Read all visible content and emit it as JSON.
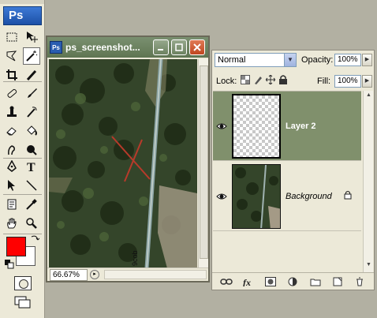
{
  "app": {
    "logo": "Ps"
  },
  "document": {
    "title": "ps_screenshot...",
    "icon_text": "Ps",
    "zoom": "66.67%",
    "canvas_label": "9cob",
    "buttons": {
      "minimize": "minimize-icon",
      "maximize": "maximize-icon",
      "close": "close-icon"
    }
  },
  "colors": {
    "foreground": "#ff0000",
    "background": "#ffffff",
    "layer_selected": "#80906c"
  },
  "layers_panel": {
    "blend_mode": "Normal",
    "opacity_label": "Opacity:",
    "opacity_value": "100%",
    "lock_label": "Lock:",
    "fill_label": "Fill:",
    "fill_value": "100%",
    "layers": [
      {
        "name": "Layer 2",
        "visible": true,
        "selected": true
      },
      {
        "name": "Background",
        "visible": true,
        "selected": false,
        "locked": true
      }
    ]
  }
}
